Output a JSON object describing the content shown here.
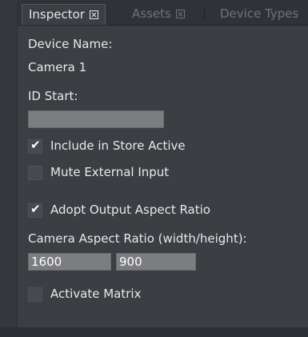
{
  "tabs": [
    {
      "label": "Inspector",
      "active": true
    },
    {
      "label": "Assets",
      "active": false
    },
    {
      "label": "Device Types",
      "active": false
    }
  ],
  "device_name": {
    "label": "Device Name:",
    "value": "Camera 1"
  },
  "id_start": {
    "label": "ID Start:",
    "value": ""
  },
  "checkboxes": {
    "include_in_store": {
      "label": "Include in Store Active",
      "checked": true
    },
    "mute_external": {
      "label": "Mute External Input",
      "checked": false
    },
    "adopt_output_aspect": {
      "label": "Adopt Output Aspect Ratio",
      "checked": true
    },
    "activate_matrix": {
      "label": "Activate Matrix",
      "checked": false
    }
  },
  "aspect_ratio": {
    "label": "Camera Aspect Ratio (width/height):",
    "width": "1600",
    "height": "900"
  },
  "check_glyph": "✔",
  "colors": {
    "panel_bg": "#3b3e42",
    "field_bg": "#7c7d7f",
    "text": "#e9e9e9",
    "inactive_tab_text": "#6f747a"
  }
}
